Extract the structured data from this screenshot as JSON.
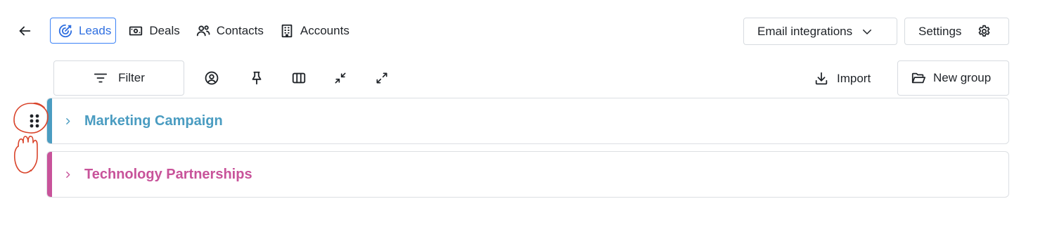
{
  "nav": {
    "back_icon": "arrow-left-icon",
    "items": [
      {
        "label": "Leads",
        "icon": "target-icon",
        "active": true
      },
      {
        "label": "Deals",
        "icon": "banknote-icon",
        "active": false
      },
      {
        "label": "Contacts",
        "icon": "users-icon",
        "active": false
      },
      {
        "label": "Accounts",
        "icon": "building-icon",
        "active": false
      }
    ],
    "email_integrations": "Email integrations",
    "settings": "Settings"
  },
  "toolbar": {
    "filter": "Filter",
    "import": "Import",
    "new_group": "New group",
    "icons": [
      "user-circle-icon",
      "pin-icon",
      "columns-icon",
      "collapse-icon",
      "expand-icon"
    ]
  },
  "groups": [
    {
      "name": "Marketing Campaign",
      "color": "#4a9cc1"
    },
    {
      "name": "Technology Partnerships",
      "color": "#c8539a"
    }
  ],
  "colors": {
    "accent": "#2f6fe0",
    "annotation": "#d9442b"
  }
}
